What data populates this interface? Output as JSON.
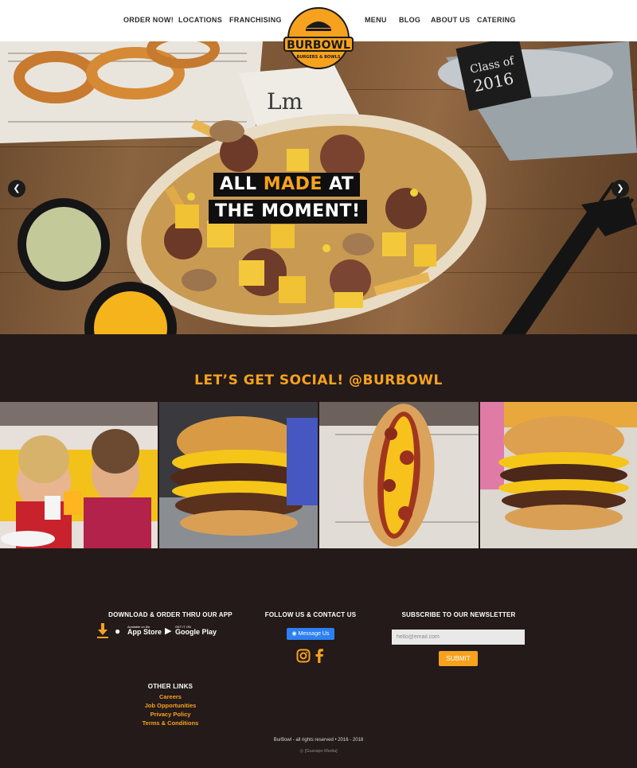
{
  "nav": {
    "left": [
      "ORDER NOW!",
      "LOCATIONS",
      "FRANCHISING"
    ],
    "right": [
      "MENU",
      "BLOG",
      "ABOUT US",
      "CATERING"
    ],
    "logo_text": "BURBOWL",
    "logo_tagline": "BURGERS & BOWLS"
  },
  "hero": {
    "line1_a": "ALL ",
    "line1_b": "MADE",
    "line1_c": " AT",
    "line2": "THE MOMENT!",
    "bucket_text_1": "Class of",
    "bucket_text_2": "2016"
  },
  "social": {
    "title": "LET’S GET SOCIAL! @BURBOWL"
  },
  "footer": {
    "app_title": "DOWNLOAD & ORDER THRU OUR APP",
    "app_store_small": "Available on the",
    "app_store_big": "App Store",
    "play_small": "GET IT ON",
    "play_big": "Google Play",
    "follow_title": "FOLLOW US & CONTACT US",
    "message_button": "Message Us",
    "newsletter_title": "SUBSCRIBE TO OUR NEWSLETTER",
    "email_placeholder": "hello@email.com",
    "submit": "SUBMIT",
    "other_title": "OTHER LINKS",
    "links": [
      "Careers",
      "Job Opportunities",
      "Privacy Policy",
      "Terms & Conditions"
    ],
    "copyright": "BurBowl - all rights reserved • 2016 - 2018",
    "credit": "[Guarapo Media]"
  },
  "colors": {
    "accent": "#f6a21e",
    "dark": "#231a19",
    "messenger": "#2d7ff2"
  }
}
